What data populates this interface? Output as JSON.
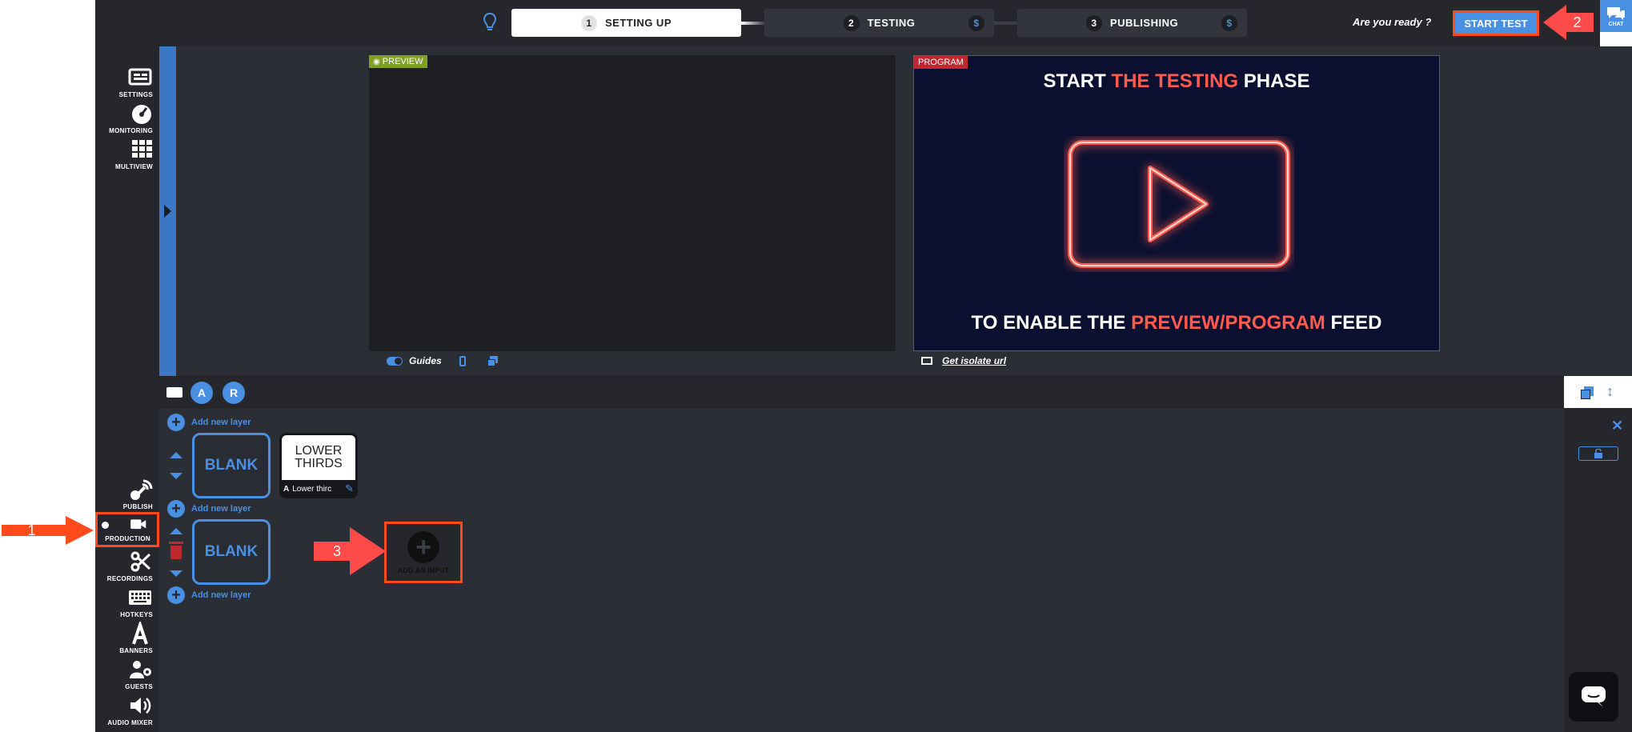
{
  "colors": {
    "accent": "#4a90e2",
    "annotation": "#ff4a1c",
    "preview_tag": "#7fa023",
    "program_tag": "#c0282d",
    "neon": "#ff5a4e"
  },
  "steps": [
    {
      "num": "1",
      "label": "SETTING UP",
      "active": true
    },
    {
      "num": "2",
      "label": "TESTING",
      "price": "$"
    },
    {
      "num": "3",
      "label": "PUBLISHING",
      "price": "$"
    }
  ],
  "header": {
    "ready_text": "Are you ready ?",
    "start_test_label": "START TEST",
    "chat_label": "CHAT"
  },
  "sidebar_top": [
    {
      "label": "SETTINGS",
      "icon": "settings-icon"
    },
    {
      "label": "MONITORING",
      "icon": "gauge-icon"
    },
    {
      "label": "MULTIVIEW",
      "icon": "grid-icon"
    }
  ],
  "sidebar_bottom": [
    {
      "label": "PUBLISH",
      "icon": "broadcast-icon"
    },
    {
      "label": "PRODUCTION",
      "icon": "camera-icon"
    },
    {
      "label": "RECORDINGS",
      "icon": "scissors-icon"
    },
    {
      "label": "HOTKEYS",
      "icon": "keyboard-icon"
    },
    {
      "label": "BANNERS",
      "icon": "text-a-icon"
    },
    {
      "label": "GUESTS",
      "icon": "guests-icon"
    },
    {
      "label": "AUDIO MIXER",
      "icon": "speaker-icon"
    }
  ],
  "preview": {
    "tag": "PREVIEW",
    "guides_label": "Guides"
  },
  "program": {
    "tag": "PROGRAM",
    "title_line1_a": "START ",
    "title_line1_hl": "THE TESTING",
    "title_line1_b": " PHASE",
    "title_line2_a": "TO ENABLE THE ",
    "title_line2_hl": "PREVIEW/PROGRAM",
    "title_line2_b": " FEED",
    "isolate_label": "Get isolate url"
  },
  "production": {
    "mode_a": "A",
    "mode_r": "R",
    "add_layer_label": "Add new layer",
    "blank_label": "BLANK",
    "lower_thirds_title": "LOWER THIRDS",
    "lower_thirds_caption": "Lower thirc",
    "add_input_label": "ADD AN INPUT"
  },
  "annotations": [
    "1",
    "2",
    "3"
  ]
}
